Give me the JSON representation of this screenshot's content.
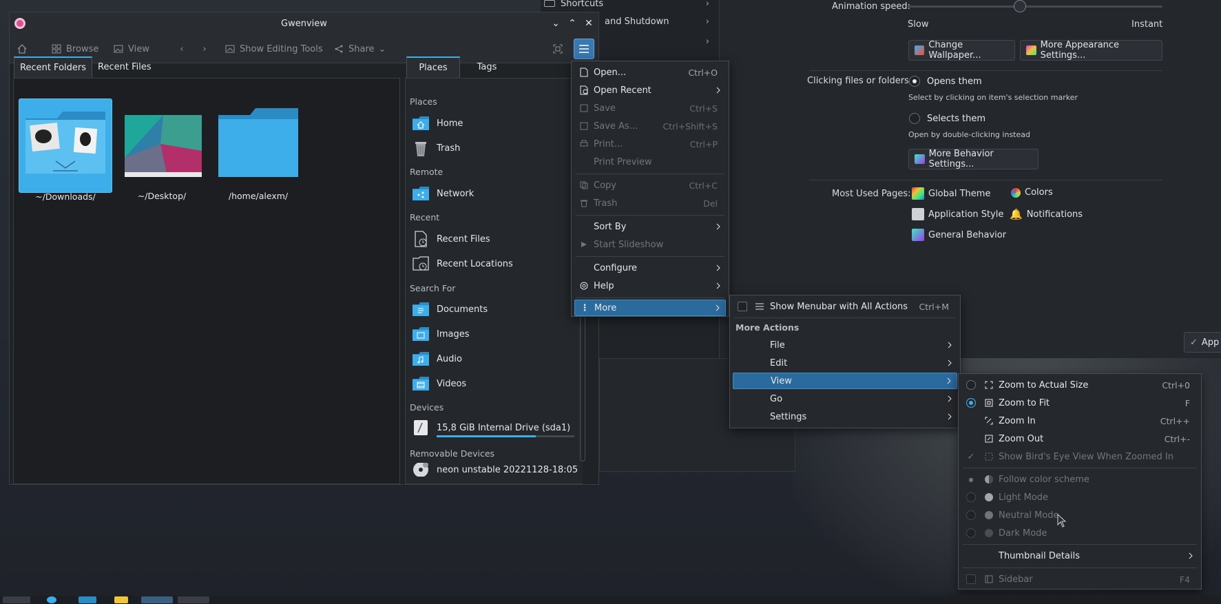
{
  "desktop": {
    "taskbar_items": 6
  },
  "settings": {
    "sidebar": [
      "Shortcuts",
      "and Shutdown"
    ],
    "animation_label": "Animation speed:",
    "slow_label": "Slow",
    "instant_label": "Instant",
    "animation_speed_value": 0.44,
    "change_wallpaper": "Change Wallpaper...",
    "more_appearance": "More Appearance Settings...",
    "clicking_label": "Clicking files or folders:",
    "opens_them": "Opens them",
    "opens_them_sub": "Select by clicking on item's selection marker",
    "selects_them": "Selects them",
    "selects_them_sub": "Open by double-clicking instead",
    "more_behavior": "More Behavior Settings...",
    "most_used_label": "Most Used Pages:",
    "global_theme": "Global Theme",
    "colors": "Colors",
    "application_style": "Application Style",
    "notifications": "Notifications",
    "general_behavior": "General Behavior",
    "apply_partial": "App"
  },
  "gwenview": {
    "title": "Gwenview",
    "toolbar": {
      "browse": "Browse",
      "view": "View",
      "show_editing_tools": "Show Editing Tools",
      "share": "Share"
    },
    "tabs": [
      "Recent Folders",
      "Recent Files"
    ],
    "folders": [
      "~/Downloads/",
      "~/Desktop/",
      "/home/alexm/"
    ],
    "places_tabs": [
      "Places",
      "Tags"
    ],
    "places": {
      "places_head": "Places",
      "home": "Home",
      "trash": "Trash",
      "remote_head": "Remote",
      "network": "Network",
      "recent_head": "Recent",
      "recent_files": "Recent Files",
      "recent_locations": "Recent Locations",
      "search_head": "Search For",
      "documents": "Documents",
      "images": "Images",
      "audio": "Audio",
      "videos": "Videos",
      "devices_head": "Devices",
      "drive": "15,8 GiB Internal Drive (sda1)",
      "drive_usage": 0.72,
      "removable_head": "Removable Devices",
      "removable": "neon unstable 20221128-18:05"
    }
  },
  "main_menu": {
    "open": "Open...",
    "open_sc": "Ctrl+O",
    "open_recent": "Open Recent",
    "save": "Save",
    "save_sc": "Ctrl+S",
    "save_as": "Save As...",
    "save_as_sc": "Ctrl+Shift+S",
    "print": "Print...",
    "print_sc": "Ctrl+P",
    "print_preview": "Print Preview",
    "copy": "Copy",
    "copy_sc": "Ctrl+C",
    "trash": "Trash",
    "trash_sc": "Del",
    "sort_by": "Sort By",
    "start_slideshow": "Start Slideshow",
    "configure": "Configure",
    "help": "Help",
    "more": "More"
  },
  "more_menu": {
    "show_menubar": "Show Menubar with All Actions",
    "show_menubar_sc": "Ctrl+M",
    "more_actions": "More Actions",
    "file": "File",
    "edit": "Edit",
    "view": "View",
    "go": "Go",
    "settings": "Settings"
  },
  "view_menu": {
    "zoom_actual": "Zoom to Actual Size",
    "zoom_actual_sc": "Ctrl+0",
    "zoom_fit": "Zoom to Fit",
    "zoom_fit_sc": "F",
    "zoom_in": "Zoom In",
    "zoom_in_sc": "Ctrl++",
    "zoom_out": "Zoom Out",
    "zoom_out_sc": "Ctrl+-",
    "birds_eye": "Show Bird's Eye View When Zoomed In",
    "follow_color": "Follow color scheme",
    "light_mode": "Light Mode",
    "neutral_mode": "Neutral Mode",
    "dark_mode": "Dark Mode",
    "thumbnail_details": "Thumbnail Details",
    "sidebar": "Sidebar",
    "sidebar_sc": "F4"
  },
  "colors": {
    "accent": "#3daee9",
    "highlight": "#2b6a9d",
    "folder": "#3daee9"
  }
}
